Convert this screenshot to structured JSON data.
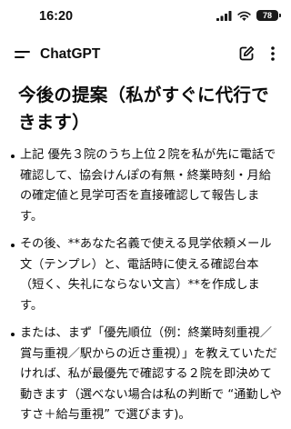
{
  "status_bar": {
    "time": "16:20",
    "battery_level": "78",
    "signal_icon": "cellular-signal-icon",
    "wifi_icon": "wifi-icon"
  },
  "header": {
    "title": "ChatGPT",
    "menu_icon": "menu-icon",
    "new_chat_icon": "new-chat-icon",
    "more_icon": "more-icon"
  },
  "message": {
    "heading": "今後の提案（私がすぐに代行できます）",
    "bullets": [
      "上記 優先３院のうち上位２院を私が先に電話で確認して、協会けんぽの有無・終業時刻・月給の確定値と見学可否を直接確認して報告します。",
      "その後、**あなた名義で使える見学依頼メール文（テンプレ）と、電話時に使える確認台本（短く、失礼にならない文言）**を作成します。",
      "または、まず「優先順位（例：終業時刻重視／賞与重視／駅からの近さ重視）」を教えていただければ、私が最優先で確認する２院を即決めて動きます（選べない場合は私の判断で “通勤しやすさ＋給与重視” で選びます)。"
    ]
  }
}
